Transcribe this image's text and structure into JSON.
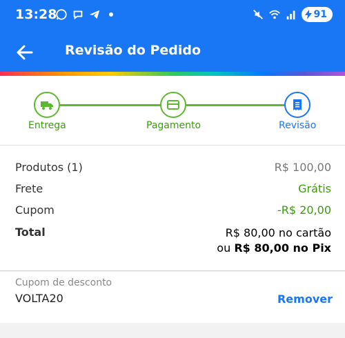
{
  "status_bar": {
    "time": "13:28",
    "battery": "91",
    "left_icons": [
      "whatsapp-icon",
      "chat-bubble-icon",
      "telegram-icon"
    ],
    "right_icons": [
      "mute-icon",
      "wifi-icon",
      "signal-icon"
    ]
  },
  "header": {
    "title": "Revisão do Pedido"
  },
  "colors": {
    "primary": "#1976f5",
    "success": "#3a9d0a",
    "step_line": "#5cb82e"
  },
  "steps": [
    {
      "label": "Entrega",
      "icon": "truck-icon",
      "state": "done"
    },
    {
      "label": "Pagamento",
      "icon": "card-icon",
      "state": "done"
    },
    {
      "label": "Revisão",
      "icon": "receipt-icon",
      "state": "current"
    }
  ],
  "summary": {
    "produtos_label": "Produtos (1)",
    "produtos_value": "R$ 100,00",
    "frete_label": "Frete",
    "frete_value": "Grátis",
    "cupom_label": "Cupom",
    "cupom_value": "-R$ 20,00",
    "total_label": "Total",
    "total_card": "R$ 80,00 no cartão",
    "total_pix_prefix": "ou ",
    "total_pix": "R$ 80,00 no Pix"
  },
  "coupon": {
    "label": "Cupom de desconto",
    "code": "VOLTA20",
    "remove_label": "Remover"
  }
}
